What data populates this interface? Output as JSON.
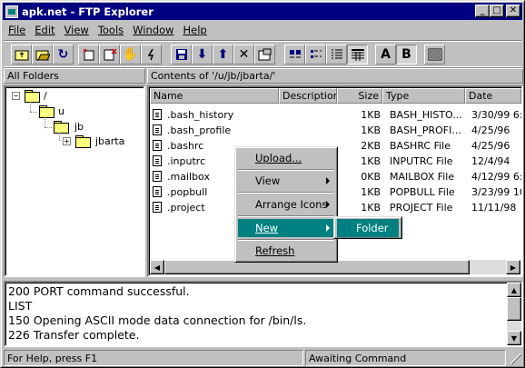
{
  "window": {
    "title": "apk.net - FTP Explorer"
  },
  "menubar": {
    "items": [
      {
        "label": "File"
      },
      {
        "label": "Edit"
      },
      {
        "label": "View"
      },
      {
        "label": "Tools"
      },
      {
        "label": "Window"
      },
      {
        "label": "Help"
      }
    ]
  },
  "toolbar": {
    "view_mode": "details",
    "font_bold": true
  },
  "left_pane": {
    "header": "All Folders"
  },
  "tree": {
    "nodes": [
      {
        "label": "/"
      },
      {
        "label": "u"
      },
      {
        "label": "jb"
      },
      {
        "label": "jbarta",
        "expander": "+"
      }
    ]
  },
  "right_pane": {
    "header": "Contents of '/u/jb/jbarta/'"
  },
  "columns": [
    "Name",
    "Description",
    "Size",
    "Type",
    "Date"
  ],
  "files": [
    {
      "name": ".bash_history",
      "size": "1KB",
      "type": "BASH_HISTO...",
      "date": "3/30/99 6:2"
    },
    {
      "name": ".bash_profile",
      "size": "1KB",
      "type": "BASH_PROFI...",
      "date": "4/25/96"
    },
    {
      "name": ".bashrc",
      "size": "2KB",
      "type": "BASHRC File",
      "date": "4/25/96"
    },
    {
      "name": ".inputrc",
      "size": "1KB",
      "type": "INPUTRC File",
      "date": "12/4/94"
    },
    {
      "name": ".mailbox",
      "size": "0KB",
      "type": "MAILBOX File",
      "date": "4/12/99 6:1"
    },
    {
      "name": ".popbull",
      "size": "1KB",
      "type": "POPBULL File",
      "date": "3/23/99 10"
    },
    {
      "name": ".project",
      "size": "1KB",
      "type": "PROJECT File",
      "date": "11/11/98"
    }
  ],
  "context_menu": {
    "items": [
      {
        "label": "Upload..."
      },
      {
        "label": "View"
      },
      {
        "label": "Arrange Icons"
      },
      {
        "label": "New"
      },
      {
        "label": "Refresh"
      }
    ]
  },
  "submenu": {
    "items": [
      {
        "label": "Folder"
      }
    ]
  },
  "log": {
    "lines": [
      "200 PORT command successful.",
      "LIST",
      "150 Opening ASCII mode data connection for /bin/ls.",
      "226 Transfer complete."
    ]
  },
  "statusbar": {
    "help": "For Help, press F1",
    "state": "Awaiting Command"
  },
  "colors": {
    "titlebar": "#000080",
    "highlight": "#008080",
    "face": "#c0c0c0"
  }
}
